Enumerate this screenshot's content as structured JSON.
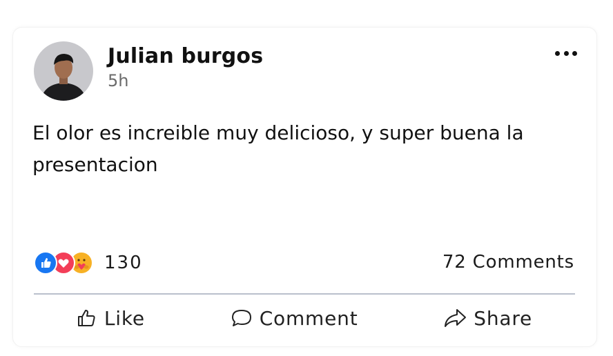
{
  "post": {
    "author": "Julian burgos",
    "time": "5h",
    "text": "El olor es increible muy delicioso, y super buena la presentacion",
    "reactions": {
      "icons": [
        "like-icon",
        "love-icon",
        "care-icon"
      ],
      "count": "130"
    },
    "comments_label": "72 Comments"
  },
  "actions": {
    "like_label": "Like",
    "comment_label": "Comment",
    "share_label": "Share"
  },
  "colors": {
    "like": "#1877f2",
    "love": "#f33e58",
    "care": "#f7b125",
    "divider": "#b9c0cc"
  }
}
